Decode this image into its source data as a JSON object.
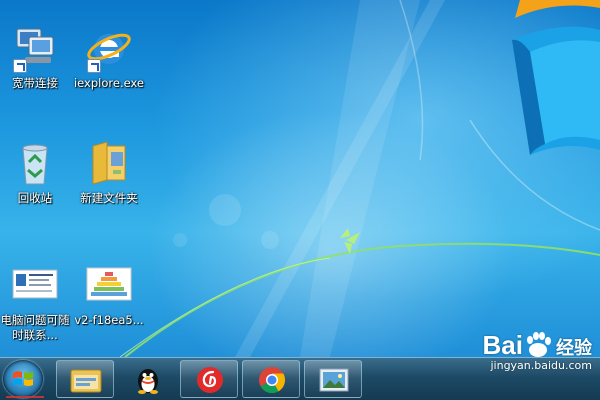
{
  "desktop": {
    "icons": [
      {
        "label": "宽带连接",
        "icon": "network-connection-icon",
        "shortcut": true
      },
      {
        "label": "iexplore.exe",
        "icon": "internet-explorer-icon",
        "shortcut": true
      },
      {
        "label": "回收站",
        "icon": "recycle-bin-icon",
        "shortcut": false
      },
      {
        "label": "新建文件夹",
        "icon": "folder-icon",
        "shortcut": false
      },
      {
        "label": "电脑问题可随时联系...",
        "icon": "image-file-icon",
        "shortcut": false
      },
      {
        "label": "v2-f18ea5...",
        "icon": "image-file-icon",
        "shortcut": false
      }
    ]
  },
  "taskbar": {
    "start": "start-button",
    "items": [
      {
        "name": "file-explorer",
        "icon": "file-explorer-icon"
      },
      {
        "name": "qq",
        "icon": "qq-penguin-icon"
      },
      {
        "name": "netease-music",
        "icon": "netease-cloud-music-icon"
      },
      {
        "name": "chrome",
        "icon": "chrome-icon"
      },
      {
        "name": "photo-viewer",
        "icon": "photo-viewer-icon"
      }
    ]
  },
  "watermark": {
    "brand": "Bai",
    "brand_suffix": "经验",
    "url": "jingyan.baidu.com"
  },
  "colors": {
    "desktop_blue": "#1d97de",
    "taskbar": "#1d4a66",
    "netease_red": "#e12a2a"
  }
}
